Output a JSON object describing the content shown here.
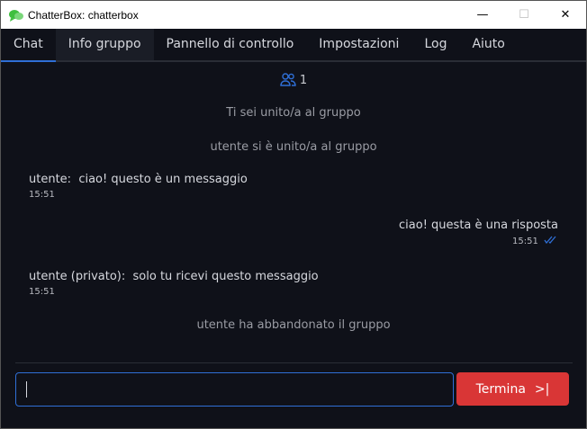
{
  "window": {
    "title": "ChatterBox: chatterbox",
    "minimize": "—",
    "maximize": "☐",
    "close": "✕"
  },
  "tabs": [
    {
      "label": "Chat"
    },
    {
      "label": "Info gruppo"
    },
    {
      "label": "Pannello di controllo"
    },
    {
      "label": "Impostazioni"
    },
    {
      "label": "Log"
    },
    {
      "label": "Aiuto"
    }
  ],
  "members": {
    "count": "1",
    "icon": "users-icon"
  },
  "messages": [
    {
      "type": "system",
      "text": "Ti sei unito/a al gruppo"
    },
    {
      "type": "system",
      "text": "utente si è unito/a al gruppo"
    },
    {
      "type": "incoming",
      "sender": "utente:",
      "text": "ciao! questo è un messaggio",
      "time": "15:51"
    },
    {
      "type": "outgoing",
      "text": "ciao! questa è una risposta",
      "time": "15:51",
      "status": "read-double-check"
    },
    {
      "type": "incoming",
      "sender": "utente (privato):",
      "text": "solo tu ricevi questo messaggio",
      "time": "15:51"
    },
    {
      "type": "system",
      "text": "utente ha abbandonato il gruppo"
    }
  ],
  "composer": {
    "value": "",
    "button_label": "Termina",
    "button_icon": ">|"
  },
  "colors": {
    "accent": "#2f6fd6",
    "danger": "#d93636",
    "background": "#0f1119"
  }
}
